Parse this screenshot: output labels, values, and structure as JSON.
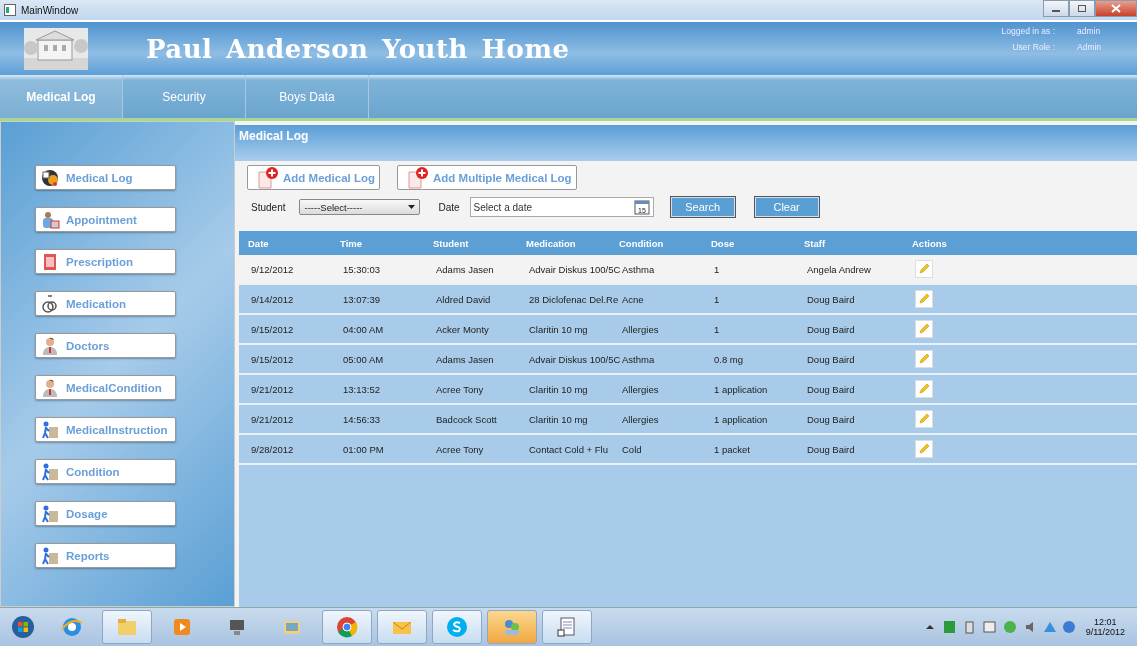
{
  "window": {
    "title": "MainWindow"
  },
  "header": {
    "title": "Paul Anderson Youth Home",
    "logged_in_label": "Logged in as :",
    "logged_in_value": "admin",
    "role_label": "User Role :",
    "role_value": "Admin"
  },
  "nav_tabs": [
    {
      "label": "Medical Log",
      "selected": true
    },
    {
      "label": "Security",
      "selected": false
    },
    {
      "label": "Boys Data",
      "selected": false
    }
  ],
  "sidebar": {
    "items": [
      {
        "label": "Medical Log",
        "kind": "log"
      },
      {
        "label": "Appointment",
        "kind": "appointment"
      },
      {
        "label": "Prescription",
        "kind": "prescription"
      },
      {
        "label": "Medication",
        "kind": "stethoscope"
      },
      {
        "label": "Doctors",
        "kind": "doctor"
      },
      {
        "label": "MedicalCondition",
        "kind": "doctor"
      },
      {
        "label": "MedicalInstruction",
        "kind": "walker"
      },
      {
        "label": "Condition",
        "kind": "walker"
      },
      {
        "label": "Dosage",
        "kind": "walker"
      },
      {
        "label": "Reports",
        "kind": "walker"
      }
    ]
  },
  "panel": {
    "title": "Medical Log",
    "add_buttons": [
      "Add Medical Log",
      "Add Multiple Medical Log"
    ],
    "student_label": "Student",
    "student_select": "-----Select-----",
    "date_label": "Date",
    "date_placeholder": "Select a date",
    "calendar_day": "15",
    "search_button": "Search",
    "clear_button": "Clear"
  },
  "table": {
    "columns": [
      "Date",
      "Time",
      "Student",
      "Medication",
      "Condition",
      "Dose",
      "Staff",
      "Actions"
    ],
    "rows": [
      {
        "cells": [
          "9/12/2012",
          "15:30:03",
          "Adams Jasen",
          "Advair Diskus 100/5C",
          "Asthma",
          "1",
          "Angela Andrew"
        ],
        "selected": true
      },
      {
        "cells": [
          "9/14/2012",
          "13:07:39",
          "Aldred David",
          "28 Diclofenac Del.Re",
          "Acne",
          "1",
          "Doug Baird"
        ],
        "selected": false
      },
      {
        "cells": [
          "9/15/2012",
          "04:00 AM",
          "Acker Monty",
          "Claritin 10 mg",
          "Allergies",
          "1",
          "Doug Baird"
        ],
        "selected": false
      },
      {
        "cells": [
          "9/15/2012",
          "05:00 AM",
          "Adams Jasen",
          "Advair Diskus 100/5C",
          "Asthma",
          "0.8 mg",
          "Doug Baird"
        ],
        "selected": false
      },
      {
        "cells": [
          "9/21/2012",
          "13:13:52",
          "Acree Tony",
          "Claritin 10 mg",
          "Allergies",
          "1 application",
          "Doug Baird"
        ],
        "selected": false
      },
      {
        "cells": [
          "9/21/2012",
          "14:56:33",
          "Badcock Scott",
          "Claritin 10 mg",
          "Allergies",
          "1 application",
          "Doug Baird"
        ],
        "selected": false
      },
      {
        "cells": [
          "9/28/2012",
          "01:00 PM",
          "Acree Tony",
          "Contact Cold + Flu",
          "Cold",
          "1 packet",
          "Doug Baird"
        ],
        "selected": false
      }
    ]
  },
  "taskbar": {
    "apps": [
      {
        "kind": "browser",
        "active": false
      },
      {
        "kind": "folder",
        "active": true
      },
      {
        "kind": "player",
        "active": false
      },
      {
        "kind": "network",
        "active": false
      },
      {
        "kind": "files",
        "active": false
      },
      {
        "kind": "chrome",
        "active": true
      },
      {
        "kind": "mail",
        "active": true
      },
      {
        "kind": "skype",
        "active": true
      },
      {
        "kind": "people",
        "active": true
      },
      {
        "kind": "document",
        "active": true
      }
    ],
    "time": "12:01",
    "date": "9/11/2012"
  }
}
